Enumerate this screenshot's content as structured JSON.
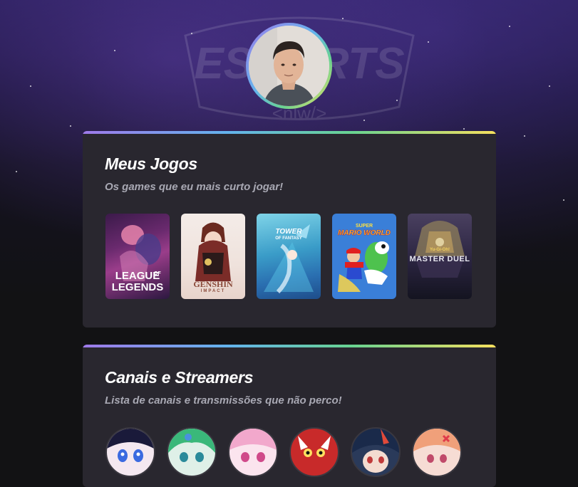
{
  "profile": {
    "avatar_icon": "person-photo"
  },
  "background": {
    "logo_text": "ESPORTS",
    "logo_sub": "<nlw/>"
  },
  "games_section": {
    "title": "Meus Jogos",
    "subtitle": "Os games que eu mais curto jogar!",
    "games": [
      {
        "name": "League of Legends",
        "cover_line1": "LEAGUE",
        "cover_of": "OF",
        "cover_line2": "LEGENDS"
      },
      {
        "name": "Genshin Impact",
        "cover_line1": "GENSHIN",
        "cover_line2": "IMPACT"
      },
      {
        "name": "Tower of Fantasy",
        "cover_line1": "TOWER",
        "cover_line2": "OF FANTASY"
      },
      {
        "name": "Super Mario World",
        "cover_line1": "SUPER",
        "cover_line2": "MARIO WORLD"
      },
      {
        "name": "Yu-Gi-Oh! Master Duel",
        "cover_line1": "Yu-Gi-Oh!",
        "cover_line2": "MASTER DUEL"
      }
    ]
  },
  "streamers_section": {
    "title": "Canais e Streamers",
    "subtitle": "Lista de canais e transmissões que não perco!",
    "streamers": [
      {
        "icon": "anime-avatar-blue-eyes"
      },
      {
        "icon": "anime-avatar-green-hair"
      },
      {
        "icon": "anime-avatar-pink-hair"
      },
      {
        "icon": "anime-avatar-red-mascot"
      },
      {
        "icon": "anime-avatar-dark-hair"
      },
      {
        "icon": "anime-avatar-orange-hair"
      }
    ]
  },
  "colors": {
    "background": "#121214",
    "card": "#29272f",
    "title": "#ffffff",
    "subtitle": "#a8a8b3",
    "gradient": [
      "#9f7aea",
      "#63b3ed",
      "#68d391",
      "#f6e05e"
    ]
  }
}
